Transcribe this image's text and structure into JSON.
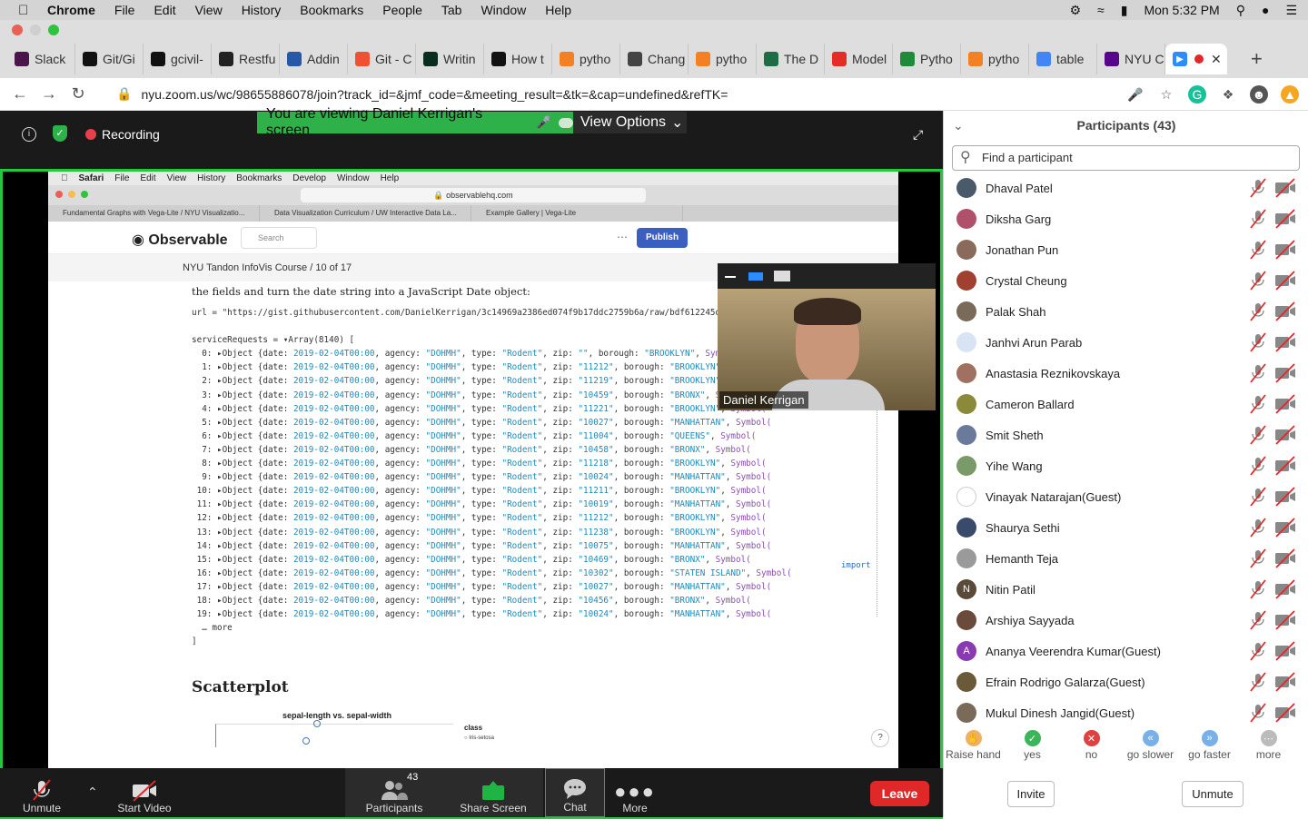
{
  "menubar": {
    "app": "Chrome",
    "items": [
      "File",
      "Edit",
      "View",
      "History",
      "Bookmarks",
      "People",
      "Tab",
      "Window",
      "Help"
    ],
    "clock": "Mon 5:32 PM"
  },
  "tabs": [
    {
      "label": "Slack",
      "color": "#4a154b"
    },
    {
      "label": "Git/Gi",
      "color": "#111"
    },
    {
      "label": "gcivil-",
      "color": "#111"
    },
    {
      "label": "Restfu",
      "color": "#222"
    },
    {
      "label": "Addin",
      "color": "#2559a7"
    },
    {
      "label": "Git - C",
      "color": "#f05133"
    },
    {
      "label": "Writin",
      "color": "#092e20"
    },
    {
      "label": "How t",
      "color": "#111"
    },
    {
      "label": "pytho",
      "color": "#f48024"
    },
    {
      "label": "Chang",
      "color": "#444"
    },
    {
      "label": "pytho",
      "color": "#f48024"
    },
    {
      "label": "The D",
      "color": "#1d6e45"
    },
    {
      "label": "Model",
      "color": "#e52d27"
    },
    {
      "label": "Pytho",
      "color": "#1e8a3a"
    },
    {
      "label": "pytho",
      "color": "#f48024"
    },
    {
      "label": "table",
      "color": "#4285f4"
    },
    {
      "label": "NYU C",
      "color": "#57068c"
    }
  ],
  "url": "nyu.zoom.us/wc/98655886078/join?track_id=&jmf_code=&meeting_result=&tk=&cap=undefined&refTK=",
  "zoom": {
    "recording": "Recording",
    "banner": "You are viewing Daniel Kerrigan's screen",
    "view_options": "View Options",
    "video_name": "Daniel Kerrigan",
    "toolbar": {
      "unmute": "Unmute",
      "start_video": "Start Video",
      "participants": "Participants",
      "participants_count": "43",
      "share": "Share Screen",
      "chat": "Chat",
      "more": "More",
      "leave": "Leave"
    }
  },
  "shared": {
    "safari_menu": [
      "Safari",
      "File",
      "Edit",
      "View",
      "History",
      "Bookmarks",
      "Develop",
      "Window",
      "Help"
    ],
    "address": "observablehq.com",
    "tabs": [
      "Fundamental Graphs with Vega-Lite / NYU Visualizatio...",
      "Data Visualization Curriculum / UW Interactive Data La...",
      "Example Gallery | Vega-Lite"
    ],
    "logo": "Observable",
    "search": "Search",
    "publish": "Publish",
    "breadcrumb": "NYU Tandon InfoVis Course / 10 of 17",
    "intro": "the fields and turn the date string into a JavaScript Date object:",
    "url_line": "url = \"https://gist.githubusercontent.com/DanielKerrigan/3c14969a2386ed074f9b17ddc2759b6a/raw/bdf612245d0cbe89407",
    "array_head": "serviceRequests = ▾Array(8140) [",
    "more": "… more",
    "close": "]",
    "section": "Scatterplot",
    "chart_title": "sepal-length vs. sepal-width",
    "legend_title": "class",
    "legend_item": "Iris-setosa",
    "side_label": "serviceRequests",
    "import_label": "import",
    "rows": [
      {
        "i": "0",
        "zip": "\"\"",
        "borough": "\"BROOKLYN\""
      },
      {
        "i": "1",
        "zip": "\"11212\"",
        "borough": "\"BROOKLYN\""
      },
      {
        "i": "2",
        "zip": "\"11219\"",
        "borough": "\"BROOKLYN\""
      },
      {
        "i": "3",
        "zip": "\"10459\"",
        "borough": "\"BRONX\""
      },
      {
        "i": "4",
        "zip": "\"11221\"",
        "borough": "\"BROOKLYN\""
      },
      {
        "i": "5",
        "zip": "\"10027\"",
        "borough": "\"MANHATTAN\""
      },
      {
        "i": "6",
        "zip": "\"11004\"",
        "borough": "\"QUEENS\""
      },
      {
        "i": "7",
        "zip": "\"10458\"",
        "borough": "\"BRONX\""
      },
      {
        "i": "8",
        "zip": "\"11218\"",
        "borough": "\"BROOKLYN\""
      },
      {
        "i": "9",
        "zip": "\"10024\"",
        "borough": "\"MANHATTAN\""
      },
      {
        "i": "10",
        "zip": "\"11211\"",
        "borough": "\"BROOKLYN\""
      },
      {
        "i": "11",
        "zip": "\"10019\"",
        "borough": "\"MANHATTAN\""
      },
      {
        "i": "12",
        "zip": "\"11212\"",
        "borough": "\"BROOKLYN\""
      },
      {
        "i": "13",
        "zip": "\"11238\"",
        "borough": "\"BROOKLYN\""
      },
      {
        "i": "14",
        "zip": "\"10075\"",
        "borough": "\"MANHATTAN\""
      },
      {
        "i": "15",
        "zip": "\"10469\"",
        "borough": "\"BRONX\""
      },
      {
        "i": "16",
        "zip": "\"10302\"",
        "borough": "\"STATEN ISLAND\""
      },
      {
        "i": "17",
        "zip": "\"10027\"",
        "borough": "\"MANHATTAN\""
      },
      {
        "i": "18",
        "zip": "\"10456\"",
        "borough": "\"BRONX\""
      },
      {
        "i": "19",
        "zip": "\"10024\"",
        "borough": "\"MANHATTAN\""
      }
    ],
    "row_date": "2019-02-04T00:00",
    "row_agency": "\"DOHMH\"",
    "row_type": "\"Rodent\""
  },
  "panel": {
    "title": "Participants (43)",
    "find_placeholder": "Find a participant",
    "participants": [
      {
        "name": "Dhaval Patel",
        "color": "#4a5a6a",
        "initial": ""
      },
      {
        "name": "Diksha Garg",
        "color": "#b0506a",
        "initial": ""
      },
      {
        "name": "Jonathan Pun",
        "color": "#8a6a5a",
        "initial": ""
      },
      {
        "name": "Crystal Cheung",
        "color": "#a04030",
        "initial": ""
      },
      {
        "name": "Palak Shah",
        "color": "#7a6a5a",
        "initial": ""
      },
      {
        "name": "Janhvi Arun Parab",
        "color": "#d8e4f4",
        "initial": ""
      },
      {
        "name": "Anastasia Reznikovskaya",
        "color": "#a07060",
        "initial": ""
      },
      {
        "name": "Cameron Ballard",
        "color": "#8a8a3a",
        "initial": ""
      },
      {
        "name": "Smit Sheth",
        "color": "#6a7a9a",
        "initial": ""
      },
      {
        "name": "Yihe Wang",
        "color": "#7a9a6a",
        "initial": ""
      },
      {
        "name": "Vinayak Natarajan(Guest)",
        "color": "#ffffff",
        "initial": ""
      },
      {
        "name": "Shaurya Sethi",
        "color": "#3a4a6a",
        "initial": ""
      },
      {
        "name": "Hemanth Teja",
        "color": "#9a9a9a",
        "initial": ""
      },
      {
        "name": "Nitin Patil",
        "color": "#5a4a3a",
        "initial": "N"
      },
      {
        "name": "Arshiya Sayyada",
        "color": "#6a4a3a",
        "initial": ""
      },
      {
        "name": "Ananya Veerendra Kumar(Guest)",
        "color": "#8a3ab0",
        "initial": "A"
      },
      {
        "name": "Efrain Rodrigo Galarza(Guest)",
        "color": "#6a5a3a",
        "initial": ""
      },
      {
        "name": "Mukul Dinesh Jangid(Guest)",
        "color": "#7a6a5a",
        "initial": ""
      }
    ],
    "reactions": [
      {
        "label": "Raise hand",
        "icon": "raise-hand-icon",
        "color": "#f0b060"
      },
      {
        "label": "yes",
        "icon": "check-icon",
        "color": "#3cb55a"
      },
      {
        "label": "no",
        "icon": "x-icon",
        "color": "#e04040"
      },
      {
        "label": "go slower",
        "icon": "rewind-icon",
        "color": "#7ab0e8"
      },
      {
        "label": "go faster",
        "icon": "fast-forward-icon",
        "color": "#7ab0e8"
      },
      {
        "label": "more",
        "icon": "more-icon",
        "color": "#bbbbbb"
      }
    ],
    "invite": "Invite",
    "unmute": "Unmute"
  }
}
